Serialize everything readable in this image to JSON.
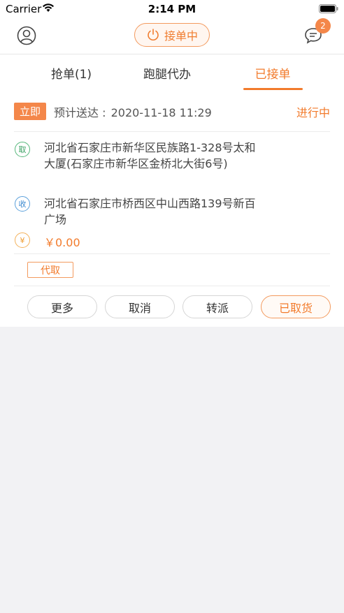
{
  "status_bar": {
    "carrier": "Carrier",
    "time": "2:14 PM"
  },
  "nav": {
    "toggle_label": "接单中",
    "message_count": "2"
  },
  "tabs": [
    {
      "label": "抢单(1)"
    },
    {
      "label": "跑腿代办"
    },
    {
      "label": "已接单"
    }
  ],
  "active_tab": "已接单",
  "order": {
    "timing_badge": "立即",
    "eta_label": "预计送达 :",
    "eta_value": "2020-11-18 11:29",
    "status": "进行中",
    "pickup_icon": "取",
    "pickup_address": "河北省石家庄市新华区民族路1-328号太和大厦(石家庄市新华区金桥北大街6号)",
    "receive_icon": "收",
    "receive_address": "河北省石家庄市桥西区中山西路139号新百广场",
    "money_icon": "¥",
    "price": "￥0.00",
    "service_tag": "代取"
  },
  "actions": {
    "more": "更多",
    "cancel": "取消",
    "transfer": "转派",
    "picked_up": "已取货"
  },
  "colors": {
    "accent": "#f27b2c",
    "pickup": "#3aa163",
    "receive": "#3d8bd0"
  }
}
